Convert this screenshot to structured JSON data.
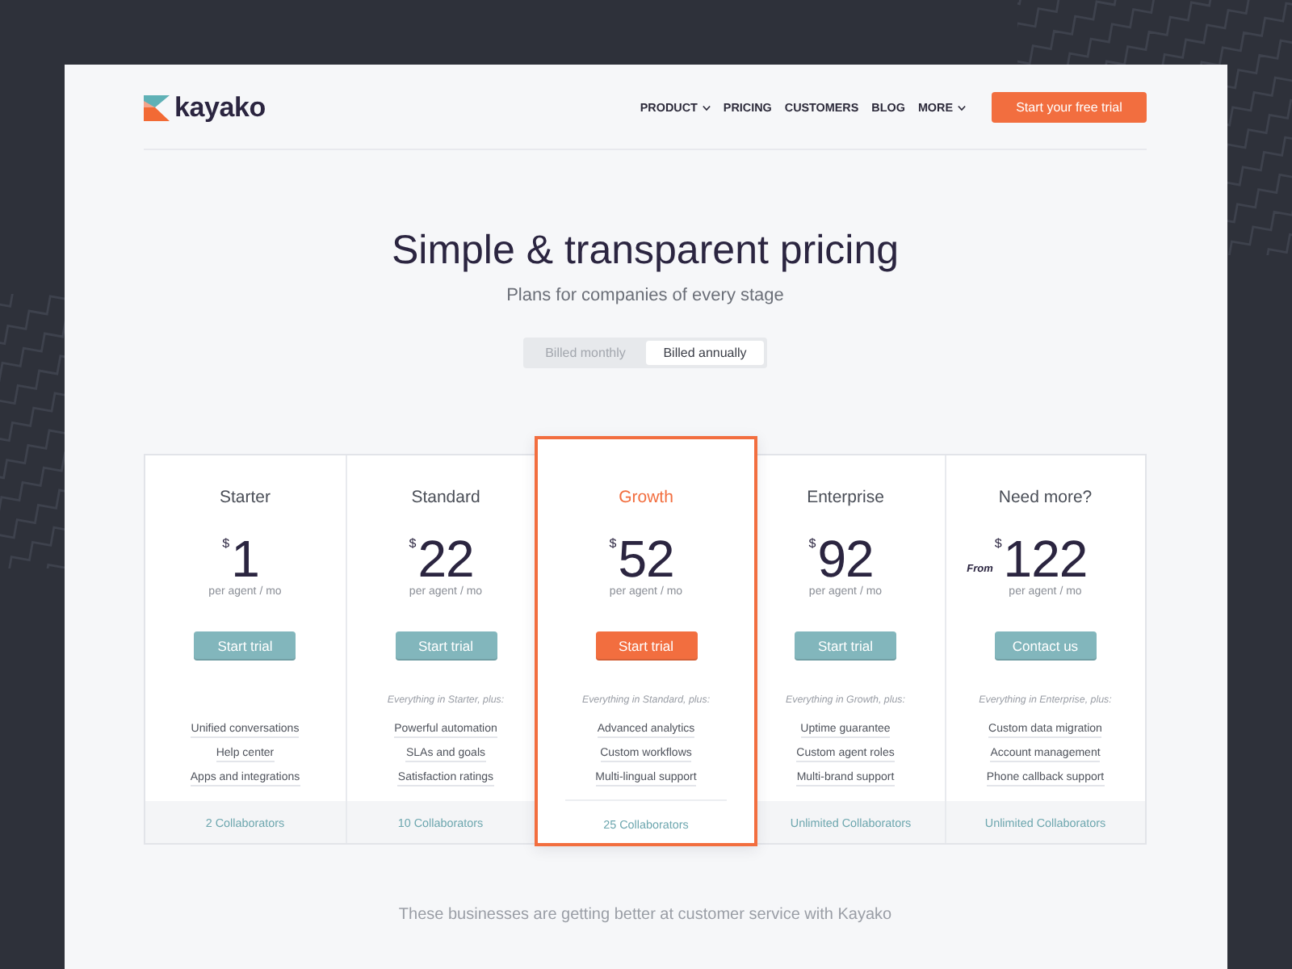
{
  "header": {
    "logo": "kayako",
    "nav": [
      {
        "label": "PRODUCT",
        "dropdown": true
      },
      {
        "label": "PRICING",
        "dropdown": false
      },
      {
        "label": "CUSTOMERS",
        "dropdown": false
      },
      {
        "label": "BLOG",
        "dropdown": false
      },
      {
        "label": "MORE",
        "dropdown": true
      }
    ],
    "cta": "Start your free trial"
  },
  "hero": {
    "title": "Simple & transparent pricing",
    "subtitle": "Plans for companies of every stage",
    "billing": [
      {
        "label": "Billed monthly",
        "selected": false
      },
      {
        "label": "Billed annually",
        "selected": true
      }
    ]
  },
  "plans": [
    {
      "name": "Starter",
      "highlighted": false,
      "price": {
        "currency": "$",
        "amount": "1"
      },
      "unit": "per agent / mo",
      "button": "Start trial",
      "features": [
        "Unified conversations",
        "Help center",
        "Apps and integrations"
      ],
      "collaborators": "2 Collaborators"
    },
    {
      "name": "Standard",
      "highlighted": false,
      "price": {
        "currency": "$",
        "amount": "22"
      },
      "unit": "per agent / mo",
      "button": "Start trial",
      "includes": "Everything in Starter, plus:",
      "features": [
        "Powerful automation",
        "SLAs and goals",
        "Satisfaction ratings"
      ],
      "collaborators": "10 Collaborators"
    },
    {
      "name": "Growth",
      "highlighted": true,
      "price": {
        "currency": "$",
        "amount": "52"
      },
      "unit": "per agent / mo",
      "button": "Start trial",
      "includes": "Everything in Standard, plus:",
      "features": [
        "Advanced analytics",
        "Custom workflows",
        "Multi-lingual support"
      ],
      "collaborators": "25 Collaborators"
    },
    {
      "name": "Enterprise",
      "highlighted": false,
      "price": {
        "currency": "$",
        "amount": "92"
      },
      "unit": "per agent / mo",
      "button": "Start trial",
      "includes": "Everything in Growth, plus:",
      "features": [
        "Uptime guarantee",
        "Custom agent roles",
        "Multi-brand support"
      ],
      "collaborators": "Unlimited Collaborators"
    },
    {
      "name": "Need more?",
      "highlighted": false,
      "price": {
        "prefix": "From",
        "currency": "$",
        "amount": "122"
      },
      "unit": "per agent / mo",
      "button": "Contact us",
      "includes": "Everything in Enterprise, plus:",
      "features": [
        "Custom data migration",
        "Account management",
        "Phone callback support"
      ],
      "collaborators": "Unlimited Collaborators"
    }
  ],
  "footer_note": "These businesses are getting better at customer service with Kayako"
}
